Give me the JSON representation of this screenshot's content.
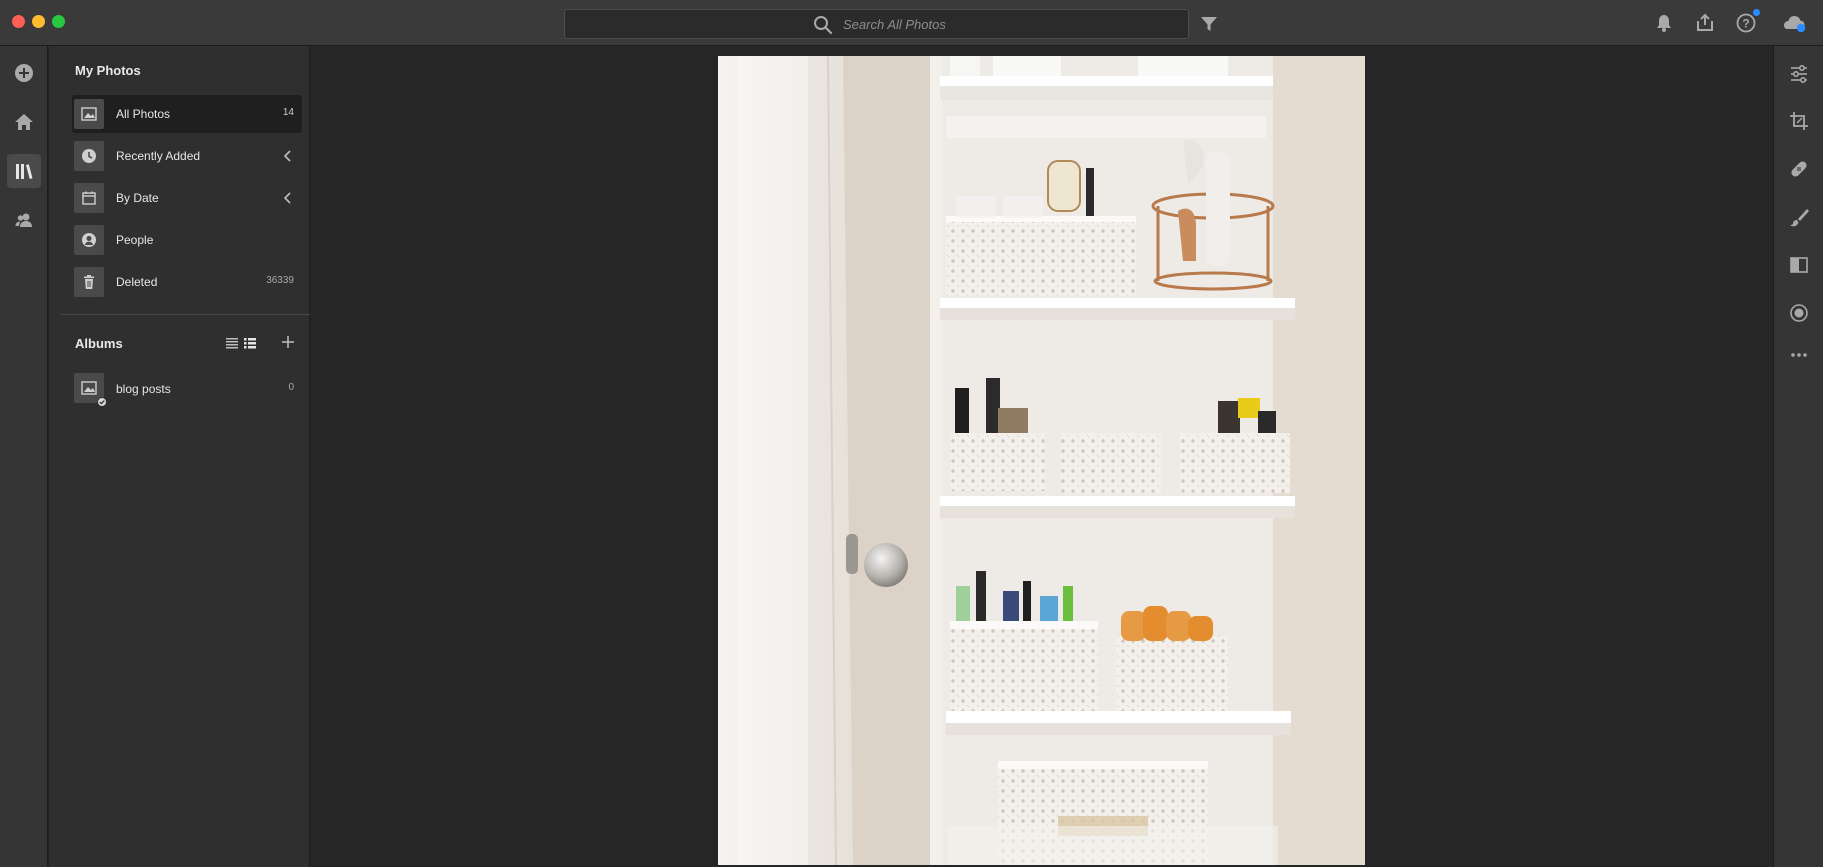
{
  "search": {
    "placeholder": "Search All Photos"
  },
  "sidebar": {
    "my_photos_title": "My Photos",
    "items": [
      {
        "label": "All Photos",
        "count": "14"
      },
      {
        "label": "Recently Added",
        "count": ""
      },
      {
        "label": "By Date",
        "count": ""
      },
      {
        "label": "People",
        "count": ""
      },
      {
        "label": "Deleted",
        "count": "36339"
      }
    ],
    "albums_title": "Albums",
    "albums": [
      {
        "label": "blog posts",
        "count": "0"
      }
    ]
  },
  "icons": {
    "left_rail": [
      "add-icon",
      "home-icon",
      "library-icon",
      "people-icon"
    ],
    "right_rail": [
      "edit-sliders-icon",
      "crop-icon",
      "healing-icon",
      "brush-icon",
      "linear-gradient-icon",
      "radial-gradient-icon",
      "more-icon"
    ],
    "top_right": [
      "bell-icon",
      "share-icon",
      "help-icon",
      "cloud-sync-icon"
    ]
  },
  "colors": {
    "accent": "#2b8cff",
    "active_item_bg": "#1f1f1f"
  }
}
